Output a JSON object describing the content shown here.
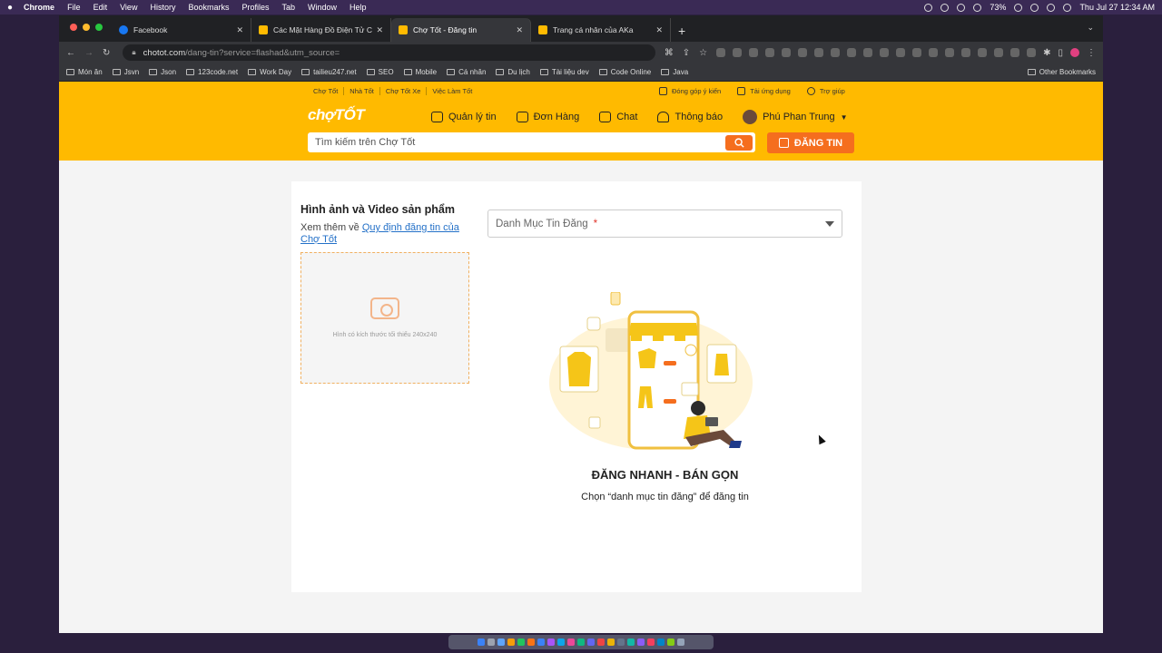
{
  "menubar": {
    "app": "Chrome",
    "items": [
      "File",
      "Edit",
      "View",
      "History",
      "Bookmarks",
      "Profiles",
      "Tab",
      "Window",
      "Help"
    ],
    "battery": "73%",
    "clock": "Thu Jul 27  12:34 AM"
  },
  "tabs": [
    {
      "title": "Facebook",
      "color": "#1877f2"
    },
    {
      "title": "Các Mặt Hàng Đồ Điện Tử Chí",
      "color": "#ffba00"
    },
    {
      "title": "Chợ Tốt - Đăng tin",
      "color": "#ffba00"
    },
    {
      "title": "Trang cá nhân của AKa",
      "color": "#ffba00"
    }
  ],
  "address": {
    "host": "chotot.com",
    "path": "/dang-tin?service=flashad&utm_source="
  },
  "bookmarks": [
    "Món ăn",
    "Jsvn",
    "Json",
    "123code.net",
    "Work Day",
    "tailieu247.net",
    "SEO",
    "Mobile",
    "Cá nhân",
    "Du lịch",
    "Tài liệu dev",
    "Code Online",
    "Java"
  ],
  "other_bookmarks": "Other Bookmarks",
  "site": {
    "topnav": [
      "Chợ Tốt",
      "Nhà Tốt",
      "Chợ Tốt Xe",
      "Việc Làm Tốt"
    ],
    "topnav_right": [
      "Đóng góp ý kiến",
      "Tải ứng dụng",
      "Trợ giúp"
    ],
    "logo": "chợTỐT",
    "nav": {
      "manage": "Quản lý tin",
      "orders": "Đơn Hàng",
      "chat": "Chat",
      "notifications": "Thông báo",
      "user": "Phú Phan Trung"
    },
    "search_placeholder": "Tìm kiếm trên Chợ Tốt",
    "post_button": "ĐĂNG TIN",
    "brand_color": "#ffba00",
    "accent_color": "#f56e1e"
  },
  "form": {
    "media_title": "Hình ảnh và Video sản phẩm",
    "media_note_prefix": "Xem thêm về ",
    "media_note_link": "Quy định đăng tin của Chợ Tốt",
    "upload_hint": "Hình có kích thước tối thiểu 240x240",
    "category_placeholder": "Danh Mục Tin Đăng",
    "required_mark": "*",
    "promo_title": "ĐĂNG NHANH - BÁN GỌN",
    "promo_subtitle": "Chọn “danh mục tin đăng” để đăng tin"
  }
}
